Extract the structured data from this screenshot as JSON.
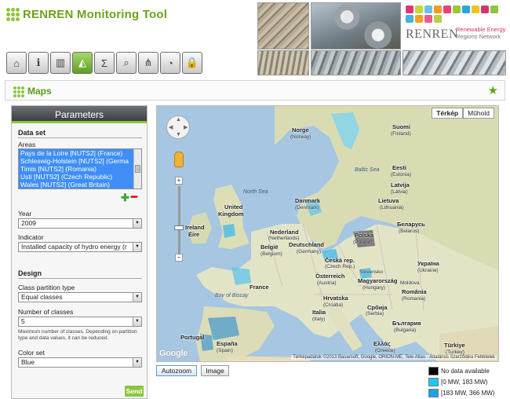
{
  "app": {
    "title": "RENREN  Monitoring Tool",
    "logo": {
      "name": "RENREN",
      "subtitle_1": "Renewable Energy",
      "subtitle_2": "Regions Network",
      "square_colors": [
        "#e7327b",
        "#c3d83a",
        "#6bc1e8",
        "#f39a24",
        "#e9417a",
        "#9ac43c",
        "#2aa7d9",
        "#f0c21d",
        "#d9336c",
        "#8cc63f",
        "#44b1e0",
        "#f7a01f",
        "#ec5b8f",
        "#b7d046"
      ]
    },
    "accent": "#8cc63f",
    "toolbar": [
      {
        "icon": "home-icon",
        "glyph": "⌂"
      },
      {
        "icon": "info-icon",
        "glyph": "ℹ"
      },
      {
        "icon": "bar-chart-icon",
        "glyph": "▥"
      },
      {
        "icon": "map-icon",
        "glyph": "◭",
        "active": true
      },
      {
        "icon": "formula-icon",
        "glyph": "Σ"
      },
      {
        "icon": "telescope-icon",
        "glyph": "⌕"
      },
      {
        "icon": "network-icon",
        "glyph": "⋔"
      },
      {
        "icon": "gauge-icon",
        "glyph": "◔"
      },
      {
        "icon": "lock-icon",
        "glyph": "🔒"
      }
    ]
  },
  "maps_bar": {
    "title": "Maps"
  },
  "params": {
    "title": "Parameters",
    "dataset": {
      "title": "Data set",
      "areas_label": "Areas",
      "areas": [
        "Pays de la Loire [NUTS2] (France)",
        "Schleswig-Holstein [NUTS2] (Germa",
        "Timis [NUTS2] (Romania)",
        "Usti [NUTS2] (Czech Republic)",
        "Wales [NUTS2] (Great Britain)"
      ],
      "year_label": "Year",
      "year_value": "2009",
      "indicator_label": "Indicator",
      "indicator_value": "Installed capacity of hydro energy (r"
    },
    "design": {
      "title": "Design",
      "partition_label": "Class partition type",
      "partition_value": "Equal classes",
      "classes_label": "Number of classes",
      "classes_value": "5",
      "classes_help": "Maximum number of classes. Depending on partition type and data values, it can be reduced.",
      "colorset_label": "Color set",
      "colorset_value": "Blue"
    },
    "send_label": "Send"
  },
  "map": {
    "type_map": "Térkép",
    "type_satellite": "Műhold",
    "google": "Google",
    "attribution": "Térképadatok ©2013 Basarsoft, Google, ORION-ME, Tele Atlas - Általános Szerződési Feltételek",
    "seas": {
      "north_sea": "North Sea",
      "baltic_sea": "Baltic Sea",
      "bay_of_biscay": "Bay of Biscay"
    },
    "labels": {
      "norge": "Norge",
      "norge_sub": "(Norway)",
      "suomi": "Suomi",
      "suomi_sub": "(Finland)",
      "eesti": "Eesti",
      "eesti_sub": "(Estonia)",
      "latvija": "Latvija",
      "latvija_sub": "(Latvia)",
      "lietuva": "Lietuva",
      "lietuva_sub": "(Lithuania)",
      "danmark": "Danmark",
      "danmark_sub": "(Denmark)",
      "uk": "United",
      "uk2": "Kingdom",
      "ireland": "Ireland",
      "eire": "Éire",
      "nederland": "Nederland",
      "nederland_sub": "(Netherlands)",
      "belgie": "België",
      "belgie_sub": "(Belgium)",
      "deutschland": "Deutschland",
      "deutschland_sub": "(Germany)",
      "polska": "Polska",
      "polska_sub": "(Poland)",
      "belarus": "Беларусь",
      "belarus_sub": "(Belarus)",
      "cesko": "Česká rep.",
      "cesko_sub": "(Czech Rep.)",
      "slovakia": "Slovensko",
      "ukraina": "Україна",
      "ukraina_sub": "(Ukraine)",
      "moldova": "Moldova",
      "oesterreich": "Österreich",
      "oesterreich_sub": "(Austria)",
      "magyar": "Magyarország",
      "magyar_sub": "(Hungary)",
      "france": "France",
      "hrvatska": "Hrvatska",
      "hrvatska_sub": "(Croatia)",
      "srbija": "Србија",
      "srbija_sub": "(Serbia)",
      "romania": "România",
      "romania_sub": "(Romania)",
      "italia": "Italia",
      "italia_sub": "(Italy)",
      "bulgaria": "България",
      "bulgaria_sub": "(Bulgaria)",
      "portugal": "Portugal",
      "espana": "España",
      "espana_sub": "(Spain)",
      "ellas": "Ελλάς",
      "ellas_sub": "(Greece)",
      "turkiye": "Türkiye",
      "turkiye_sub": "(Turkey)"
    }
  },
  "buttons": {
    "autozoom": "Autozoom",
    "image": "Image"
  },
  "legend": [
    {
      "label": "No data available",
      "color": "#000000"
    },
    {
      "label": "[0 MW, 183 MW)",
      "color": "#1fc6f5"
    },
    {
      "label": "[183 MW, 366 MW)",
      "color": "#1aa2e8"
    }
  ]
}
